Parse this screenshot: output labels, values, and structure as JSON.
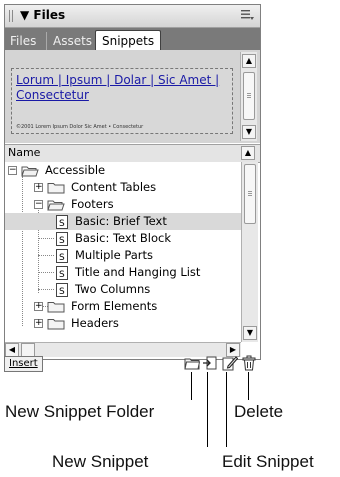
{
  "panel": {
    "title": "▼ Files",
    "options_icon": "options-menu-icon",
    "tabs": [
      {
        "label": "Files",
        "active": false
      },
      {
        "label": "Assets",
        "active": false
      },
      {
        "label": "Snippets",
        "active": true
      }
    ]
  },
  "preview": {
    "links": "Lorum | Ipsum | Dolar | Sic Amet | Consectetur",
    "footer": "©2001 Lorem Ipsum Dolor Sic Amet • Consectetur"
  },
  "list": {
    "column_header": "Name",
    "items": [
      {
        "label": "Accessible",
        "type": "folder",
        "expander": "−"
      },
      {
        "label": "Content Tables",
        "type": "folder",
        "expander": "+"
      },
      {
        "label": "Footers",
        "type": "folder",
        "expander": "−"
      },
      {
        "label": "Basic: Brief Text",
        "type": "snippet",
        "selected": true
      },
      {
        "label": "Basic: Text Block",
        "type": "snippet"
      },
      {
        "label": "Multiple Parts",
        "type": "snippet"
      },
      {
        "label": "Title and Hanging List",
        "type": "snippet"
      },
      {
        "label": "Two Columns",
        "type": "snippet"
      },
      {
        "label": "Form Elements",
        "type": "folder",
        "expander": "+"
      },
      {
        "label": "Headers",
        "type": "folder",
        "expander": "+"
      }
    ]
  },
  "footer": {
    "insert_label": "Insert",
    "tools": [
      "new-snippet-folder-icon",
      "new-snippet-icon",
      "edit-snippet-icon",
      "delete-icon"
    ]
  },
  "callouts": {
    "new_snippet_folder": "New Snippet Folder",
    "delete": "Delete",
    "new_snippet": "New Snippet",
    "edit_snippet": "Edit Snippet"
  }
}
